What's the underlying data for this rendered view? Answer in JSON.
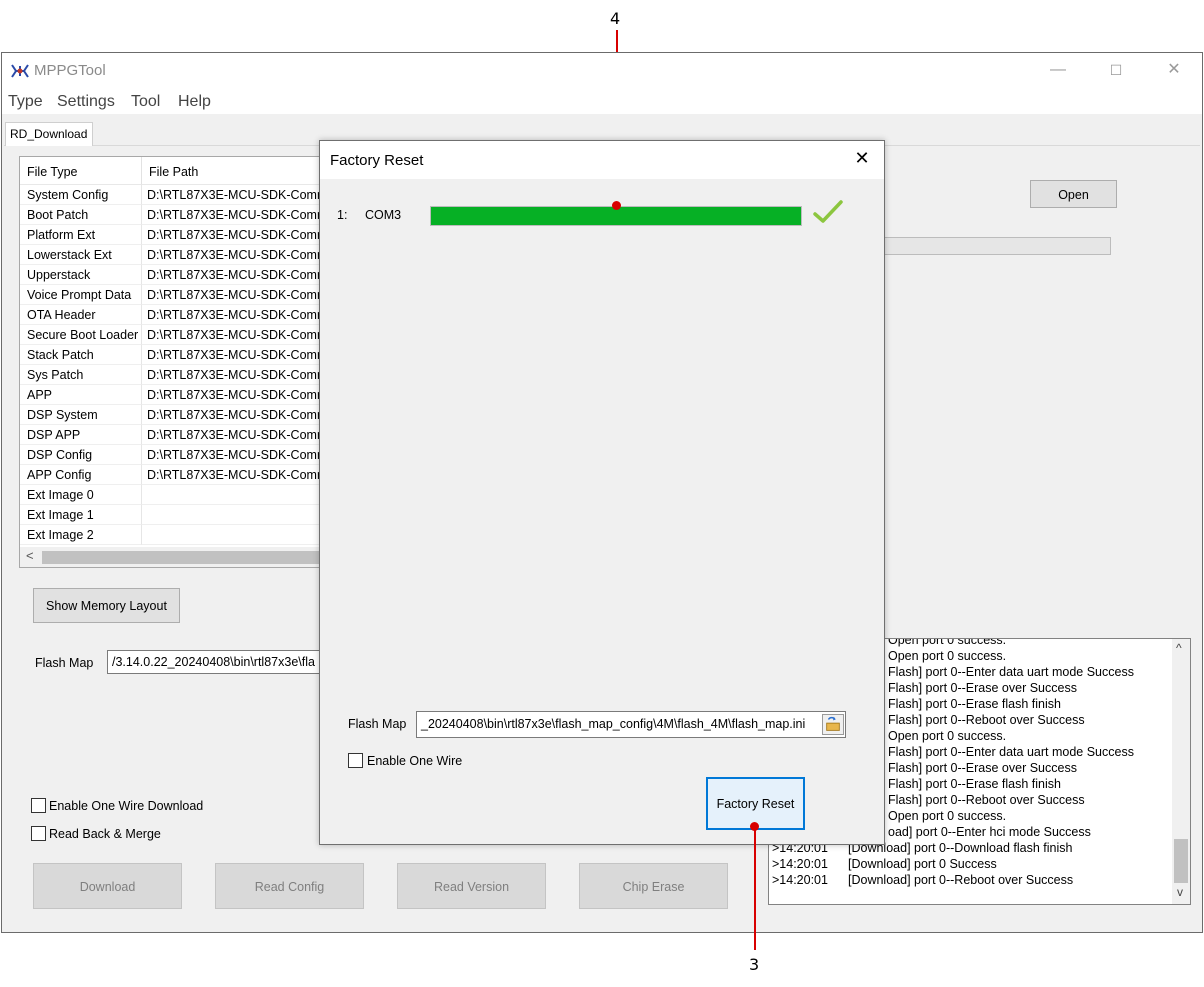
{
  "window": {
    "title": "MPPGTool",
    "controls": {
      "minimize": "—",
      "maximize": "☐",
      "close": "✕"
    }
  },
  "menu": [
    "Type",
    "Settings",
    "Tool",
    "Help"
  ],
  "tab": "RD_Download",
  "file_table": {
    "headers": [
      "File Type",
      "File Path"
    ],
    "rows": [
      {
        "type": "System Config",
        "path": "D:\\RTL87X3E-MCU-SDK-Comm"
      },
      {
        "type": "Boot Patch",
        "path": "D:\\RTL87X3E-MCU-SDK-Comm"
      },
      {
        "type": "Platform Ext",
        "path": "D:\\RTL87X3E-MCU-SDK-Comm"
      },
      {
        "type": "Lowerstack Ext",
        "path": "D:\\RTL87X3E-MCU-SDK-Comm"
      },
      {
        "type": "Upperstack",
        "path": "D:\\RTL87X3E-MCU-SDK-Comm"
      },
      {
        "type": "Voice Prompt Data",
        "path": "D:\\RTL87X3E-MCU-SDK-Comm"
      },
      {
        "type": "OTA Header",
        "path": "D:\\RTL87X3E-MCU-SDK-Comm"
      },
      {
        "type": "Secure Boot Loader",
        "path": "D:\\RTL87X3E-MCU-SDK-Comm"
      },
      {
        "type": "Stack Patch",
        "path": "D:\\RTL87X3E-MCU-SDK-Comm"
      },
      {
        "type": "Sys Patch",
        "path": "D:\\RTL87X3E-MCU-SDK-Comm"
      },
      {
        "type": "APP",
        "path": "D:\\RTL87X3E-MCU-SDK-Comm"
      },
      {
        "type": "DSP System",
        "path": "D:\\RTL87X3E-MCU-SDK-Comm"
      },
      {
        "type": "DSP APP",
        "path": "D:\\RTL87X3E-MCU-SDK-Comm"
      },
      {
        "type": "DSP Config",
        "path": "D:\\RTL87X3E-MCU-SDK-Comm"
      },
      {
        "type": "APP Config",
        "path": "D:\\RTL87X3E-MCU-SDK-Comm"
      },
      {
        "type": "Ext Image 0",
        "path": ""
      },
      {
        "type": "Ext Image 1",
        "path": ""
      },
      {
        "type": "Ext Image 2",
        "path": ""
      }
    ],
    "scroll_left": "<"
  },
  "main": {
    "open_button": "Open",
    "show_memory_layout": "Show Memory Layout",
    "flash_map_label": "Flash Map",
    "flash_map_value": "/3.14.0.22_20240408\\bin\\rtl87x3e\\fla",
    "enable_one_wire_download": "Enable One Wire Download",
    "read_back_merge": "Read Back & Merge",
    "buttons": [
      "Download",
      "Read Config",
      "Read Version",
      "Chip Erase"
    ]
  },
  "log": [
    {
      "time": "",
      "text": "Open port 0 success."
    },
    {
      "time": "",
      "text": "Open port 0 success."
    },
    {
      "time": "",
      "text": "Flash] port 0--Enter data uart mode Success"
    },
    {
      "time": "",
      "text": "Flash] port 0--Erase over Success"
    },
    {
      "time": "",
      "text": "Flash] port 0--Erase flash finish"
    },
    {
      "time": "",
      "text": "Flash] port 0--Reboot over Success"
    },
    {
      "time": "",
      "text": "Open port 0 success."
    },
    {
      "time": "",
      "text": "Flash] port 0--Enter data uart mode Success"
    },
    {
      "time": "",
      "text": "Flash] port 0--Erase over Success"
    },
    {
      "time": "",
      "text": "Flash] port 0--Erase flash finish"
    },
    {
      "time": "",
      "text": "Flash] port 0--Reboot over Success"
    },
    {
      "time": "",
      "text": "Open port 0 success."
    },
    {
      "time": "",
      "text": "oad] port 0--Enter hci mode Success"
    },
    {
      "time": ">14:20:01",
      "text": "[Download] port 0--Download flash finish"
    },
    {
      "time": ">14:20:01",
      "text": "[Download] port 0 Success"
    },
    {
      "time": ">14:20:01",
      "text": "[Download] port 0--Reboot over Success"
    }
  ],
  "log_scroll": {
    "up": "^",
    "down": "v"
  },
  "dialog": {
    "title": "Factory Reset",
    "close": "✕",
    "port_index": "1:",
    "port_name": "COM3",
    "progress": 1.0,
    "status_icon": "check-icon",
    "flash_map_label": "Flash Map",
    "flash_map_value": "_20240408\\bin\\rtl87x3e\\flash_map_config\\4M\\flash_4M\\flash_map.ini",
    "enable_one_wire": "Enable One Wire",
    "factory_reset_button": "Factory Reset"
  },
  "annotations": {
    "top": "4",
    "bottom": "3"
  },
  "colors": {
    "progress_fill": "#06b025",
    "annotation": "#d80000",
    "check": "#8cc63f"
  }
}
